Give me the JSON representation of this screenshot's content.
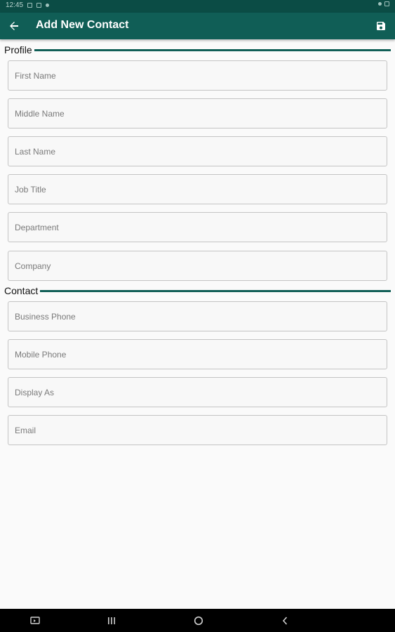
{
  "status_bar": {
    "time": "12:45"
  },
  "app_bar": {
    "title": "Add New Contact",
    "back_icon": "arrow-back-icon",
    "save_icon": "save-icon",
    "color": "#105e56"
  },
  "sections": {
    "profile": {
      "label": "Profile",
      "fields": [
        {
          "placeholder": "First Name",
          "value": ""
        },
        {
          "placeholder": "Middle Name",
          "value": ""
        },
        {
          "placeholder": "Last Name",
          "value": ""
        },
        {
          "placeholder": "Job Title",
          "value": ""
        },
        {
          "placeholder": "Department",
          "value": ""
        },
        {
          "placeholder": "Company",
          "value": ""
        }
      ]
    },
    "contact": {
      "label": "Contact",
      "fields": [
        {
          "placeholder": "Business Phone",
          "value": ""
        },
        {
          "placeholder": "Mobile Phone",
          "value": ""
        },
        {
          "placeholder": "Display As",
          "value": ""
        },
        {
          "placeholder": "Email",
          "value": ""
        }
      ]
    }
  },
  "nav_bar": {
    "icons": [
      "screenshot-icon",
      "recent-apps-icon",
      "home-icon",
      "back-icon"
    ]
  }
}
